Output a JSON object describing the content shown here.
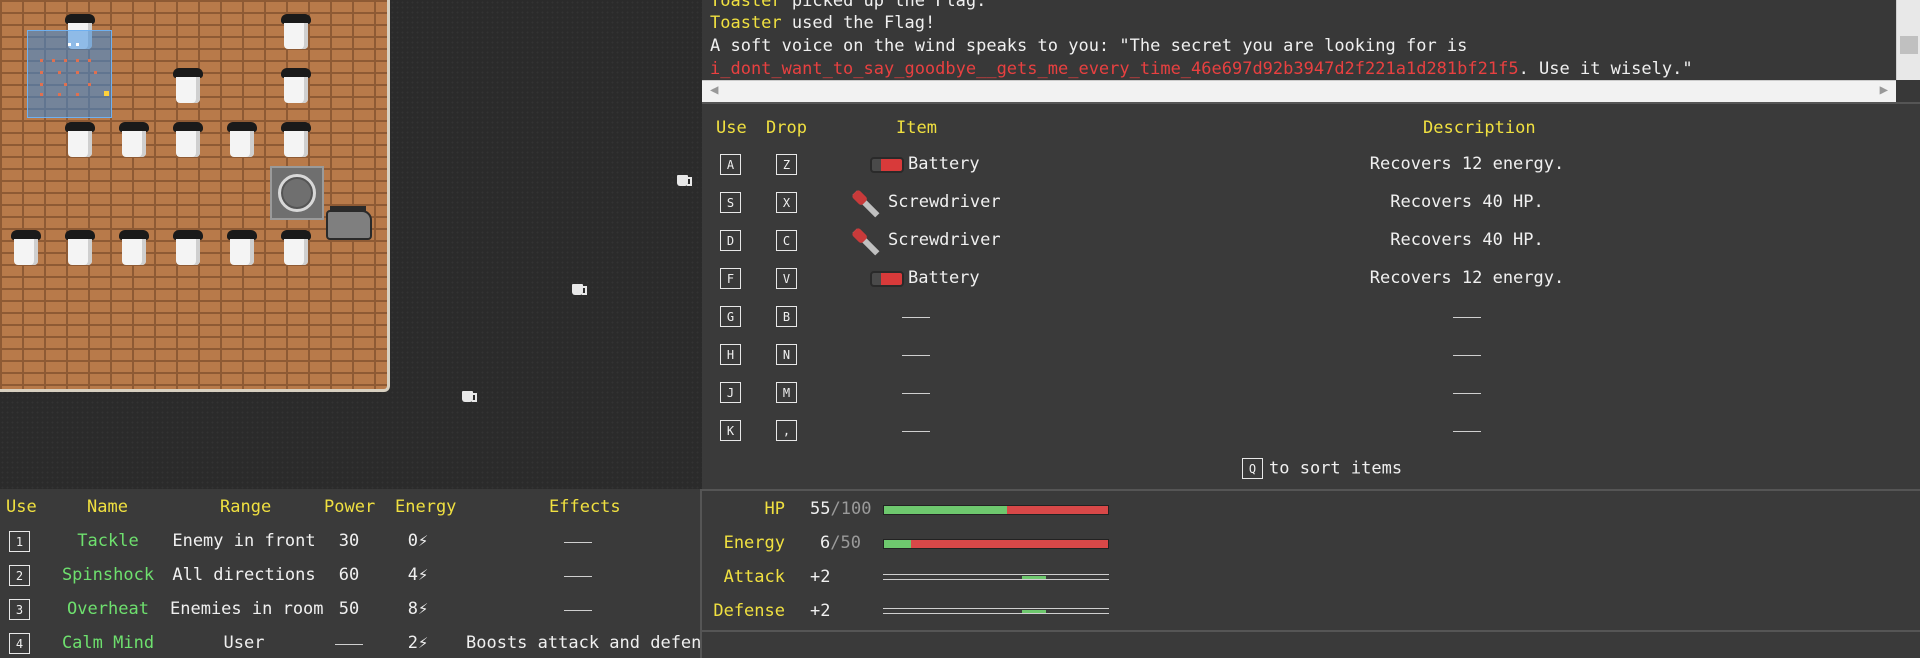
{
  "log": {
    "line0_name": "Toaster",
    "line0_text": " picked up the Flag.",
    "line1_name": "Toaster",
    "line1_text": " used the Flag!",
    "line2_text": "A soft voice on the wind speaks to you: \"The secret you are looking for is",
    "line3_secret": "i_dont_want_to_say_goodbye__gets_me_every_time_46e697d92b3947d2f221a1d281bf21f5",
    "line3_text": ". Use it wisely.\""
  },
  "inventory": {
    "headers": {
      "use": "Use",
      "drop": "Drop",
      "item": "Item",
      "description": "Description"
    },
    "rows": [
      {
        "use": "A",
        "drop": "Z",
        "item": "Battery",
        "desc": "Recovers 12 energy.",
        "icon": "battery-icon"
      },
      {
        "use": "S",
        "drop": "X",
        "item": "Screwdriver",
        "desc": "Recovers 40 HP.",
        "icon": "screwdriver-icon"
      },
      {
        "use": "D",
        "drop": "C",
        "item": "Screwdriver",
        "desc": "Recovers 40 HP.",
        "icon": "screwdriver-icon"
      },
      {
        "use": "F",
        "drop": "V",
        "item": "Battery",
        "desc": "Recovers 12 energy.",
        "icon": "battery-icon"
      },
      {
        "use": "G",
        "drop": "B",
        "item": "",
        "desc": ""
      },
      {
        "use": "H",
        "drop": "N",
        "item": "",
        "desc": ""
      },
      {
        "use": "J",
        "drop": "M",
        "item": "",
        "desc": ""
      },
      {
        "use": "K",
        "drop": ",",
        "item": "",
        "desc": ""
      }
    ],
    "sort_key": "Q",
    "sort_text": "to sort items"
  },
  "skills": {
    "headers": {
      "use": "Use",
      "name": "Name",
      "range": "Range",
      "power": "Power",
      "energy": "Energy",
      "effects": "Effects"
    },
    "rows": [
      {
        "key": "1",
        "name": "Tackle",
        "range": "Enemy in front",
        "power": "30",
        "energy": "0⚡",
        "effects": ""
      },
      {
        "key": "2",
        "name": "Spinshock",
        "range": "All directions",
        "power": "60",
        "energy": "4⚡",
        "effects": ""
      },
      {
        "key": "3",
        "name": "Overheat",
        "range": "Enemies in room",
        "power": "50",
        "energy": "8⚡",
        "effects": ""
      },
      {
        "key": "4",
        "name": "Calm Mind",
        "range": "User",
        "power": "",
        "energy": "2⚡",
        "effects": "Boosts attack and defense."
      }
    ]
  },
  "stats": {
    "hp_label": "HP",
    "hp_value": "55",
    "hp_max": "/100",
    "hp_fraction": 0.55,
    "energy_label": "Energy",
    "energy_value": "6",
    "energy_max": "/50",
    "energy_fraction": 0.12,
    "attack_label": "Attack",
    "attack_value": "+2",
    "attack_level": 2,
    "defense_label": "Defense",
    "defense_value": "+2",
    "defense_level": 2
  },
  "colors": {
    "accent_yellow": "#f0e040",
    "secret_red": "#e84040",
    "skill_green": "#6ee06e",
    "bar_green": "#6ec86e",
    "bar_red": "#d84848"
  }
}
